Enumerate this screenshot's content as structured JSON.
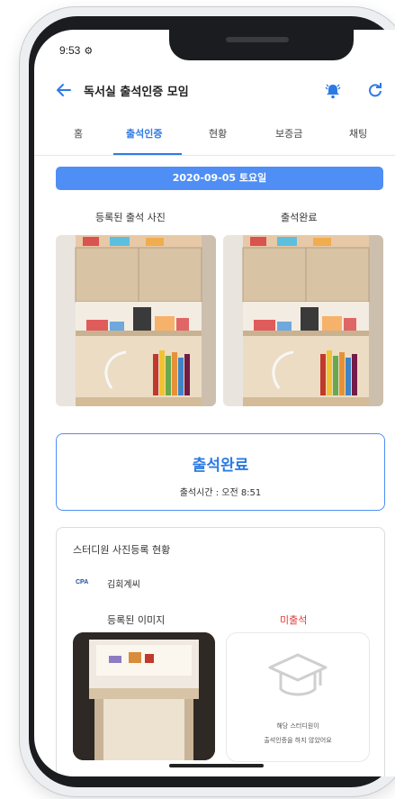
{
  "status_bar": {
    "time": "9:53",
    "icon": "gear-icon"
  },
  "header": {
    "title": "독서실 출석인증 모임",
    "back_icon": "back-arrow-icon",
    "bell_icon": "bell-icon",
    "refresh_icon": "refresh-icon"
  },
  "tabs": [
    {
      "label": "홈"
    },
    {
      "label": "출석인증",
      "active": true
    },
    {
      "label": "현황"
    },
    {
      "label": "보증금"
    },
    {
      "label": "채팅"
    }
  ],
  "date_banner": "2020-09-05 토요일",
  "photos": {
    "left_label": "등록된 출석 사진",
    "right_label": "출석완료"
  },
  "attendance": {
    "title": "출석완료",
    "time": "출석시간 : 오전 8:51"
  },
  "status_card": {
    "title": "스터디원 사진등록 현황",
    "member": {
      "name": "김회계씨"
    },
    "registered_label": "등록된 이미지",
    "missing_label": "미출석",
    "missing_message_1": "해당 스터디원이",
    "missing_message_2": "출석인증을 하지 않았어요"
  },
  "colors": {
    "accent": "#2c7be5",
    "banner": "#4f8ef5",
    "absent": "#e53935"
  }
}
